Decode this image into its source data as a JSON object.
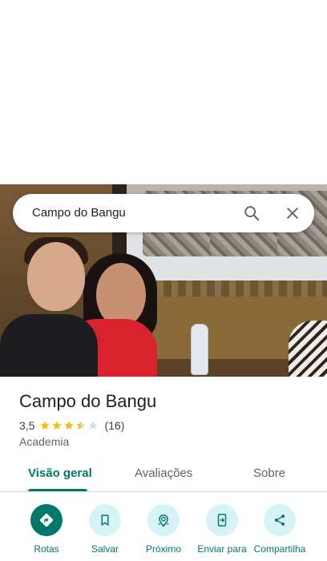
{
  "search": {
    "query": "Campo do Bangu"
  },
  "place": {
    "name": "Campo do Bangu",
    "rating": "3,5",
    "rating_value": 3.5,
    "review_count": "(16)",
    "category": "Academia"
  },
  "tabs": [
    {
      "label": "Visão geral",
      "active": true
    },
    {
      "label": "Avaliações",
      "active": false
    },
    {
      "label": "Sobre",
      "active": false
    }
  ],
  "actions": [
    {
      "label": "Rotas",
      "icon": "directions-icon",
      "primary": true
    },
    {
      "label": "Salvar",
      "icon": "bookmark-icon",
      "primary": false
    },
    {
      "label": "Próximo",
      "icon": "nearby-icon",
      "primary": false
    },
    {
      "label": "Enviar para",
      "icon": "send-to-phone-icon",
      "primary": false
    },
    {
      "label": "Compartilha",
      "icon": "share-icon",
      "primary": false
    }
  ],
  "colors": {
    "accent": "#00796b",
    "action_bg": "#d6f3f7",
    "star": "#fbbc04",
    "star_empty": "#dadce0"
  }
}
